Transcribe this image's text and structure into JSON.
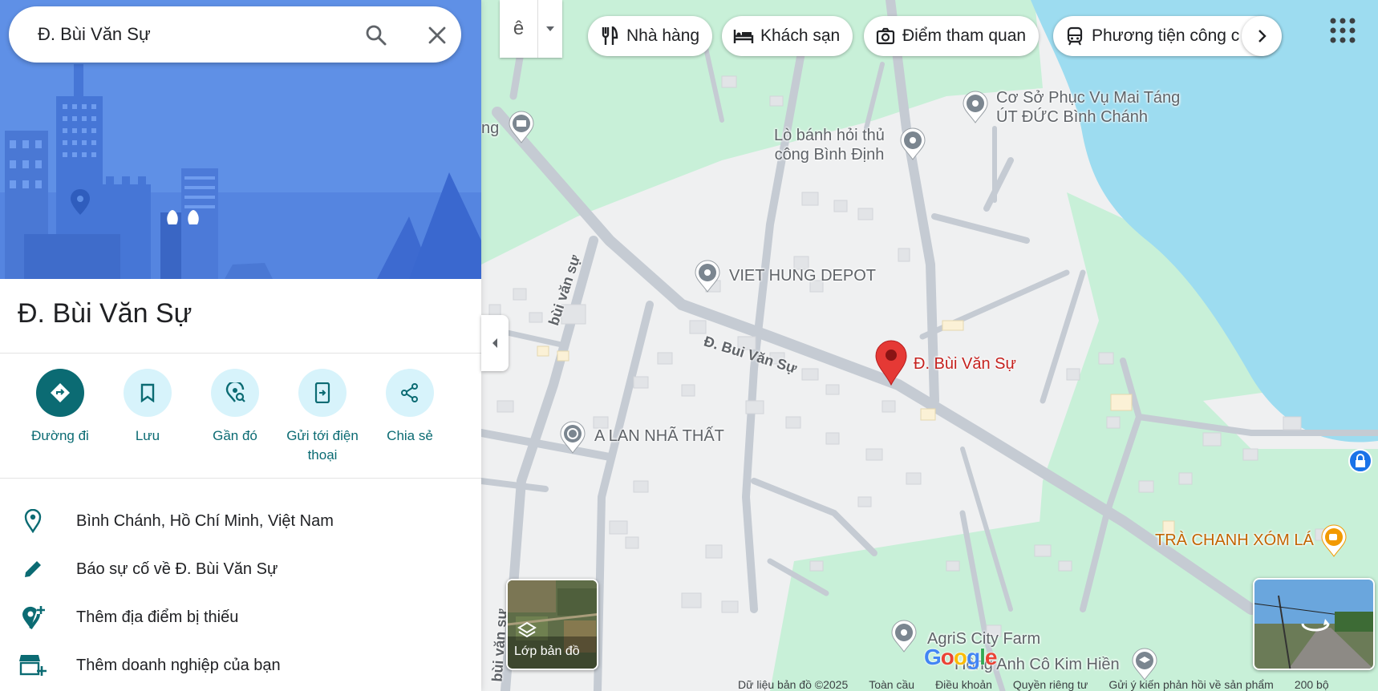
{
  "search": {
    "value": "Đ. Bùi Văn Sự"
  },
  "place": {
    "title": "Đ. Bùi Văn Sự"
  },
  "actions": [
    {
      "label": "Đường đi",
      "icon": "directions-icon"
    },
    {
      "label": "Lưu",
      "icon": "bookmark-icon"
    },
    {
      "label": "Gần đó",
      "icon": "nearby-icon"
    },
    {
      "label": "Gửi tới điện thoại",
      "icon": "send-to-phone-icon"
    },
    {
      "label": "Chia sẻ",
      "icon": "share-icon"
    }
  ],
  "info": [
    {
      "text": "Bình Chánh, Hồ Chí Minh, Việt Nam",
      "icon": "location-pin-icon"
    },
    {
      "text": "Báo sự cố về Đ. Bùi Văn Sự",
      "icon": "edit-pencil-icon"
    },
    {
      "text": "Thêm địa điểm bị thiếu",
      "icon": "add-place-icon"
    },
    {
      "text": "Thêm doanh nghiệp của bạn",
      "icon": "add-business-icon"
    }
  ],
  "ime": {
    "label": "ê"
  },
  "chips": [
    {
      "label": "Nhà hàng",
      "icon": "restaurant-icon"
    },
    {
      "label": "Khách sạn",
      "icon": "hotel-icon"
    },
    {
      "label": "Điểm tham quan",
      "icon": "camera-icon"
    },
    {
      "label": "Phương tiện công c",
      "icon": "transit-icon"
    }
  ],
  "map": {
    "pois": {
      "funeral": "Cơ Sở Phục Vụ Mai Táng\nÚT ĐỨC Bình Chánh",
      "bakery": "Lò bánh hỏi thủ\ncông Bình Định",
      "depot": "VIET HUNG DEPOT",
      "selected": "Đ. Bùi Văn Sự",
      "alan": "A LAN NHÃ THẤT",
      "tra_chanh": "TRÀ CHANH XÓM LÁ",
      "agris": "AgriS City Farm",
      "school": "Hồng Anh Cô Kim Hiền",
      "partial_left": "ng"
    },
    "roads": {
      "main": "Đ. Bui Văn Sự",
      "vertical": "bùi văn sự",
      "vertical_left": "bùi văn sự"
    },
    "layers_label": "Lớp bản đồ",
    "colors": {
      "water": "#9ddcf0",
      "park": "#c8f0d8",
      "land": "#eff0f1",
      "road": "#c5cbd3",
      "pin": "#e53935"
    }
  },
  "footer": {
    "copyright": "Dữ liệu bản đồ ©2025",
    "global": "Toàn cầu",
    "terms": "Điều khoản",
    "privacy": "Quyền riêng tư",
    "feedback": "Gửi ý kiến phản hồi về sản phẩm",
    "scale": "200 bộ"
  }
}
